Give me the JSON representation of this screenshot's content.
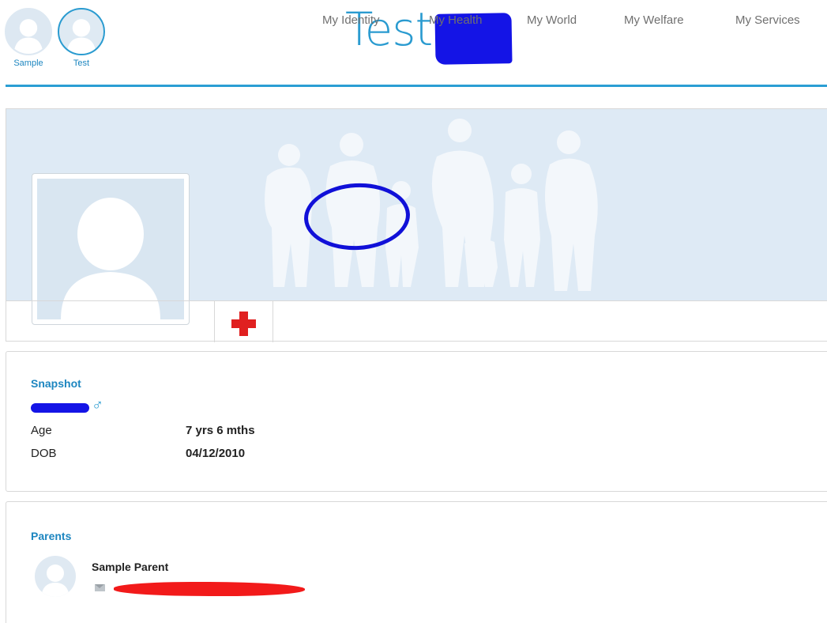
{
  "profiles": [
    {
      "label": "Sample",
      "active": false
    },
    {
      "label": "Test",
      "active": true
    }
  ],
  "header": {
    "title": "Test",
    "accent_color": "#2a9bd0"
  },
  "nav": {
    "health_icon": "red-cross-icon",
    "tabs": [
      {
        "label": "My Identity"
      },
      {
        "label": "My Health"
      },
      {
        "label": "My World"
      },
      {
        "label": "My Welfare"
      },
      {
        "label": "My Services"
      }
    ]
  },
  "snapshot": {
    "title": "Snapshot",
    "gender_symbol": "♂",
    "age_label": "Age",
    "age_value": "7 yrs 6 mths",
    "dob_label": "DOB",
    "dob_value": "04/12/2010"
  },
  "parents": {
    "title": "Parents",
    "items": [
      {
        "name": "Sample Parent",
        "contact_icon": "mail-icon"
      }
    ]
  }
}
